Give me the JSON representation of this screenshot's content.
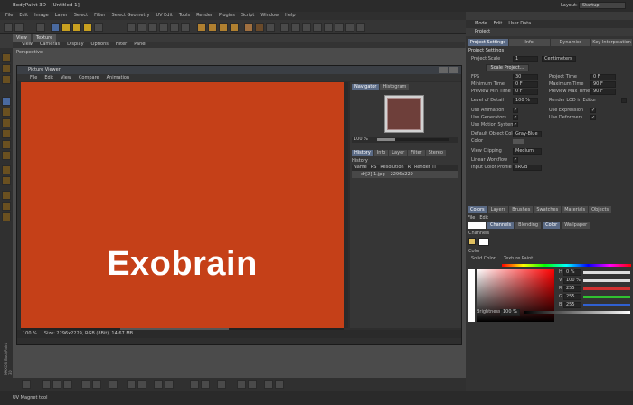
{
  "app": {
    "title": "BodyPaint 3D - [Untitled 1]",
    "layout_label": "Layout:",
    "layout_value": "Startup"
  },
  "menubar": [
    "File",
    "Edit",
    "Image",
    "Layer",
    "Select",
    "Filter",
    "Select Geometry",
    "UV Edit",
    "Tools",
    "Render",
    "Plugins",
    "Script",
    "Window",
    "Help"
  ],
  "view_tabs": [
    "View",
    "Texture"
  ],
  "view_menu": [
    "View",
    "Cameras",
    "Display",
    "Options",
    "Filter",
    "Panel"
  ],
  "viewport_label": "Perspective",
  "picture_viewer": {
    "title": "Picture Viewer",
    "menu": [
      "File",
      "Edit",
      "View",
      "Compare",
      "Animation"
    ],
    "image_text": "Exobrain",
    "nav_tabs": [
      "Navigator",
      "Histogram"
    ],
    "zoom": "100 %",
    "hist_tabs": [
      "History",
      "Info",
      "Layer",
      "Filter",
      "Stereo"
    ],
    "history_label": "History",
    "history_columns": [
      "Name",
      "RS",
      "Resolution",
      "R",
      "Render Ti"
    ],
    "history_row": {
      "name": "dr[2]-1.jpg",
      "resolution": "2296x229"
    },
    "status_zoom": "100 %",
    "status_text": "Size: 2296x2229, RGB (8Bit), 14.67 MB"
  },
  "right_panel": {
    "menu": [
      "Mode",
      "Edit",
      "User Data"
    ],
    "title": "Project",
    "tabs": [
      "Project Settings",
      "Info",
      "Dynamics",
      "Key Interpolation"
    ],
    "section": "Project Settings",
    "project_scale_label": "Project Scale",
    "project_scale_value": "1",
    "project_scale_unit": "Centimeters",
    "scale_button": "Scale Project...",
    "fields_left": [
      {
        "label": "FPS",
        "value": "30"
      },
      {
        "label": "Minimum Time",
        "value": "0 F"
      },
      {
        "label": "Preview Min Time",
        "value": "0 F"
      },
      {
        "label": "Level of Detail",
        "value": "100 %"
      }
    ],
    "fields_right": [
      {
        "label": "Project Time",
        "value": "0 F"
      },
      {
        "label": "Maximum Time",
        "value": "90 F"
      },
      {
        "label": "Preview Max Time",
        "value": "90 F"
      },
      {
        "label": "Render LOD in Editor",
        "value": ""
      }
    ],
    "checks_left": [
      "Use Animation",
      "Use Generators",
      "Use Motion System"
    ],
    "checks_right": [
      "Use Expression",
      "Use Deformers"
    ],
    "default_color_label": "Default Object Color",
    "default_color_value": "Gray-Blue",
    "color_label": "Color",
    "view_clipping_label": "View Clipping",
    "view_clipping_value": "Medium",
    "linear_label": "Linear Workflow",
    "input_profile_label": "Input Color Profile",
    "input_profile_value": "sRGB"
  },
  "color_panel": {
    "tabs": [
      "Colors",
      "Layers",
      "Brushes",
      "Swatches",
      "Materials",
      "Objects"
    ],
    "sub": [
      "File",
      "Edit"
    ],
    "modes": [
      "Channels",
      "Blending",
      "Color",
      "Wallpaper"
    ],
    "channels_label": "Channels",
    "color_label": "Color",
    "solid_color": "Solid Color",
    "texture_paint": "Texture Paint",
    "sliders": [
      {
        "label": "H",
        "value": "0 %",
        "color": "#dddddd"
      },
      {
        "label": "V",
        "value": "100 %",
        "color": "#dddddd"
      },
      {
        "label": "R",
        "value": "255",
        "color": "#d03030"
      },
      {
        "label": "G",
        "value": "255",
        "color": "#30c030"
      },
      {
        "label": "B",
        "value": "255",
        "color": "#3060d0"
      }
    ],
    "brightness_label": "Brightness",
    "brightness_value": "100 %"
  },
  "side_text": "MAXON BodyPaint 3D",
  "status": "UV Magnet tool"
}
